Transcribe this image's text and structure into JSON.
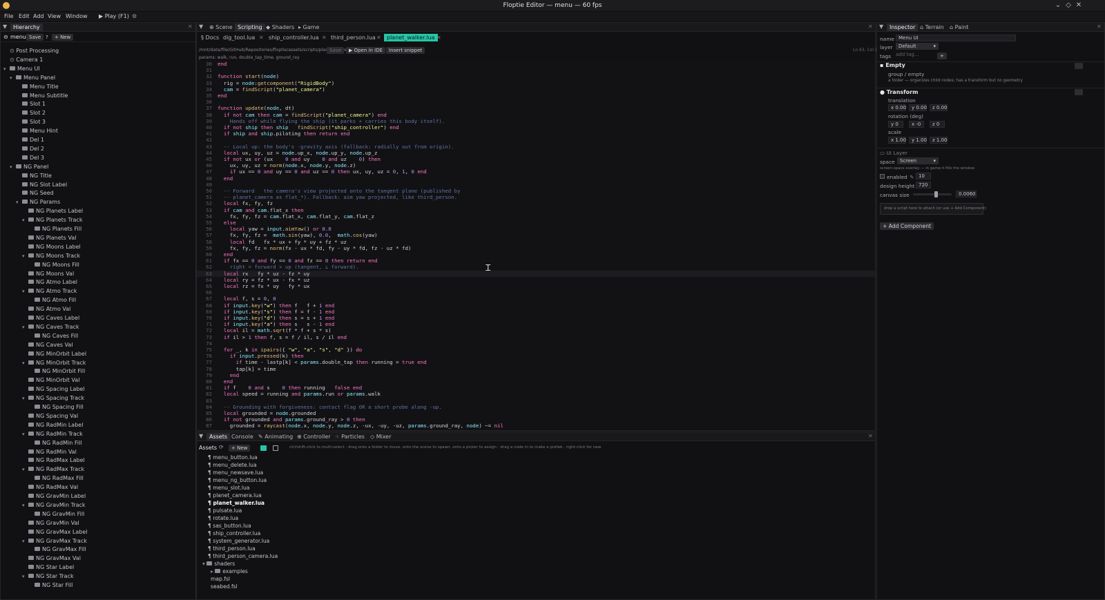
{
  "window": {
    "title": "Floptie Editor — menu — 60 fps"
  },
  "menubar": {
    "items": [
      "File",
      "Edit",
      "Add",
      "View",
      "Window"
    ],
    "play_label": "▶ Play (F1)"
  },
  "hierarchy": {
    "tab": "Hierarchy",
    "scene_name": "menu",
    "save_label": "Save",
    "help_label": "?",
    "new_label": "+ New",
    "rows": [
      {
        "label": "Post Processing",
        "depth": 0,
        "kind": "node",
        "open": false
      },
      {
        "label": "Camera 1",
        "depth": 0,
        "kind": "node",
        "open": false
      },
      {
        "label": "Menu UI",
        "depth": 0,
        "kind": "folder",
        "open": true
      },
      {
        "label": "Menu Panel",
        "depth": 1,
        "kind": "folder",
        "open": true
      },
      {
        "label": "Menu Title",
        "depth": 2,
        "kind": "folder",
        "open": false
      },
      {
        "label": "Menu Subtitle",
        "depth": 2,
        "kind": "folder",
        "open": false
      },
      {
        "label": "Slot 1",
        "depth": 2,
        "kind": "folder",
        "open": false
      },
      {
        "label": "Slot 2",
        "depth": 2,
        "kind": "folder",
        "open": false
      },
      {
        "label": "Slot 3",
        "depth": 2,
        "kind": "folder",
        "open": false
      },
      {
        "label": "Menu Hint",
        "depth": 2,
        "kind": "folder",
        "open": false
      },
      {
        "label": "Del 1",
        "depth": 2,
        "kind": "folder",
        "open": false
      },
      {
        "label": "Del 2",
        "depth": 2,
        "kind": "folder",
        "open": false
      },
      {
        "label": "Del 3",
        "depth": 2,
        "kind": "folder",
        "open": false
      },
      {
        "label": "NG Panel",
        "depth": 1,
        "kind": "folder",
        "open": true
      },
      {
        "label": "NG Title",
        "depth": 2,
        "kind": "folder",
        "open": false
      },
      {
        "label": "NG Slot Label",
        "depth": 2,
        "kind": "folder",
        "open": false
      },
      {
        "label": "NG Seed",
        "depth": 2,
        "kind": "folder",
        "open": false
      },
      {
        "label": "NG Params",
        "depth": 2,
        "kind": "folder",
        "open": true
      },
      {
        "label": "NG Planets Label",
        "depth": 3,
        "kind": "folder",
        "open": false
      },
      {
        "label": "NG Planets Track",
        "depth": 3,
        "kind": "folder",
        "open": true
      },
      {
        "label": "NG Planets Fill",
        "depth": 4,
        "kind": "folder",
        "open": false
      },
      {
        "label": "NG Planets Val",
        "depth": 3,
        "kind": "folder",
        "open": false
      },
      {
        "label": "NG Moons Label",
        "depth": 3,
        "kind": "folder",
        "open": false
      },
      {
        "label": "NG Moons Track",
        "depth": 3,
        "kind": "folder",
        "open": true
      },
      {
        "label": "NG Moons Fill",
        "depth": 4,
        "kind": "folder",
        "open": false
      },
      {
        "label": "NG Moons Val",
        "depth": 3,
        "kind": "folder",
        "open": false
      },
      {
        "label": "NG Atmo Label",
        "depth": 3,
        "kind": "folder",
        "open": false
      },
      {
        "label": "NG Atmo Track",
        "depth": 3,
        "kind": "folder",
        "open": true
      },
      {
        "label": "NG Atmo Fill",
        "depth": 4,
        "kind": "folder",
        "open": false
      },
      {
        "label": "NG Atmo Val",
        "depth": 3,
        "kind": "folder",
        "open": false
      },
      {
        "label": "NG Caves Label",
        "depth": 3,
        "kind": "folder",
        "open": false
      },
      {
        "label": "NG Caves Track",
        "depth": 3,
        "kind": "folder",
        "open": true
      },
      {
        "label": "NG Caves Fill",
        "depth": 4,
        "kind": "folder",
        "open": false
      },
      {
        "label": "NG Caves Val",
        "depth": 3,
        "kind": "folder",
        "open": false
      },
      {
        "label": "NG MinOrbit Label",
        "depth": 3,
        "kind": "folder",
        "open": false
      },
      {
        "label": "NG MinOrbit Track",
        "depth": 3,
        "kind": "folder",
        "open": true
      },
      {
        "label": "NG MinOrbit Fill",
        "depth": 4,
        "kind": "folder",
        "open": false
      },
      {
        "label": "NG MinOrbit Val",
        "depth": 3,
        "kind": "folder",
        "open": false
      },
      {
        "label": "NG Spacing Label",
        "depth": 3,
        "kind": "folder",
        "open": false
      },
      {
        "label": "NG Spacing Track",
        "depth": 3,
        "kind": "folder",
        "open": true
      },
      {
        "label": "NG Spacing Fill",
        "depth": 4,
        "kind": "folder",
        "open": false
      },
      {
        "label": "NG Spacing Val",
        "depth": 3,
        "kind": "folder",
        "open": false
      },
      {
        "label": "NG RadMin Label",
        "depth": 3,
        "kind": "folder",
        "open": false
      },
      {
        "label": "NG RadMin Track",
        "depth": 3,
        "kind": "folder",
        "open": true
      },
      {
        "label": "NG RadMin Fill",
        "depth": 4,
        "kind": "folder",
        "open": false
      },
      {
        "label": "NG RadMin Val",
        "depth": 3,
        "kind": "folder",
        "open": false
      },
      {
        "label": "NG RadMax Label",
        "depth": 3,
        "kind": "folder",
        "open": false
      },
      {
        "label": "NG RadMax Track",
        "depth": 3,
        "kind": "folder",
        "open": true
      },
      {
        "label": "NG RadMax Fill",
        "depth": 4,
        "kind": "folder",
        "open": false
      },
      {
        "label": "NG RadMax Val",
        "depth": 3,
        "kind": "folder",
        "open": false
      },
      {
        "label": "NG GravMin Label",
        "depth": 3,
        "kind": "folder",
        "open": false
      },
      {
        "label": "NG GravMin Track",
        "depth": 3,
        "kind": "folder",
        "open": true
      },
      {
        "label": "NG GravMin Fill",
        "depth": 4,
        "kind": "folder",
        "open": false
      },
      {
        "label": "NG GravMin Val",
        "depth": 3,
        "kind": "folder",
        "open": false
      },
      {
        "label": "NG GravMax Label",
        "depth": 3,
        "kind": "folder",
        "open": false
      },
      {
        "label": "NG GravMax Track",
        "depth": 3,
        "kind": "folder",
        "open": true
      },
      {
        "label": "NG GravMax Fill",
        "depth": 4,
        "kind": "folder",
        "open": false
      },
      {
        "label": "NG GravMax Val",
        "depth": 3,
        "kind": "folder",
        "open": false
      },
      {
        "label": "NG Star Label",
        "depth": 3,
        "kind": "folder",
        "open": false
      },
      {
        "label": "NG Star Track",
        "depth": 3,
        "kind": "folder",
        "open": true
      },
      {
        "label": "NG Star Fill",
        "depth": 4,
        "kind": "folder",
        "open": false
      }
    ]
  },
  "editor": {
    "top_tabs": [
      "⊕ Scene",
      "Scripting",
      "◆ Shaders",
      "▸ Game"
    ],
    "active_top_tab": 1,
    "file_tabs": [
      "§ Docs",
      "dig_tool.lua",
      "ship_controller.lua",
      "third_person.lua",
      "planet_walker.lua"
    ],
    "active_file_tab": 4,
    "path": "/mnt/data/file/GitHub/Repositories/floptie/assets/scripts/planet_walker.lua",
    "save_label": "Save",
    "open_ide_label": "▶ Open in IDE",
    "insert_snippet_label": "Insert snippet",
    "cursor_pos": "Ln 63, Col 11",
    "params_line": "params: walk, run, double_tap_time, ground_ray",
    "accent_color": "#26c6a6",
    "code": [
      {
        "n": 30,
        "t": "end"
      },
      {
        "n": 31,
        "t": ""
      },
      {
        "n": 32,
        "t": "function start(node)"
      },
      {
        "n": 33,
        "t": "  rig = node:getcomponent(\"RigidBody\")"
      },
      {
        "n": 34,
        "t": "  cam = findScript(\"planet_camera\")"
      },
      {
        "n": 35,
        "t": "end"
      },
      {
        "n": 36,
        "t": ""
      },
      {
        "n": 37,
        "t": "function update(node, dt)"
      },
      {
        "n": 38,
        "t": "  if not cam then cam = findScript(\"planet_camera\") end"
      },
      {
        "n": 39,
        "t": "    Hands off while flying the ship (it parks + carries this body itself)."
      },
      {
        "n": 40,
        "t": "  if not ship then ship   findScript(\"ship_controller\") end"
      },
      {
        "n": 41,
        "t": "  if ship and ship.piloting then return end"
      },
      {
        "n": 42,
        "t": ""
      },
      {
        "n": 43,
        "t": "  -- Local up: the body's -gravity axis (fallback: radially out from origin)."
      },
      {
        "n": 44,
        "t": "  local ux, uy, uz = node.up_x, node.up_y, node.up_z"
      },
      {
        "n": 45,
        "t": "  if not ux or (ux    0 and uy    0 and uz    0) then"
      },
      {
        "n": 46,
        "t": "    ux, uy, uz = norm(node.x, node.y, node.z)"
      },
      {
        "n": 47,
        "t": "    if ux == 0 and uy == 0 and uz == 0 then ux, uy, uz = 0, 1, 0 end"
      },
      {
        "n": 48,
        "t": "  end"
      },
      {
        "n": 49,
        "t": ""
      },
      {
        "n": 50,
        "t": "  -- Forward   the camera's view projected onto the tangent plane (published by"
      },
      {
        "n": 51,
        "t": "  -- planet_camera as flat_*). Fallback: aim yaw projected, like third_person."
      },
      {
        "n": 52,
        "t": "  local fx, fy, fz"
      },
      {
        "n": 53,
        "t": "  if cam and cam.flat_x then"
      },
      {
        "n": 54,
        "t": "    fx, fy, fz = cam.flat_x, cam.flat_y, cam.flat_z"
      },
      {
        "n": 55,
        "t": "  else"
      },
      {
        "n": 56,
        "t": "    local yaw = input.aimYaw() or 0.0"
      },
      {
        "n": 57,
        "t": "    fx, fy, fz =  math.sin(yaw), 0.0,  math.cos(yaw)"
      },
      {
        "n": 58,
        "t": "    local fd   fx * ux + fy * uy + fz * uz"
      },
      {
        "n": 59,
        "t": "    fx, fy, fz = norm(fx - ux * fd, fy - uy * fd, fz - uz * fd)"
      },
      {
        "n": 60,
        "t": "  end"
      },
      {
        "n": 61,
        "t": "  if fx == 0 and fy == 0 and fz == 0 then return end"
      },
      {
        "n": 62,
        "t": "    right = forward × up (tangent, ⊥ forward)."
      },
      {
        "n": 63,
        "t": "  local rx   fy * uz - fz * uy"
      },
      {
        "n": 64,
        "t": "  local ry = fz * ux - fx * uz"
      },
      {
        "n": 65,
        "t": "  local rz = fx * uy   fy * ux"
      },
      {
        "n": 66,
        "t": ""
      },
      {
        "n": 67,
        "t": "  local f, s = 0, 0"
      },
      {
        "n": 68,
        "t": "  if input.key(\"w\") then f   f + 1 end"
      },
      {
        "n": 69,
        "t": "  if input.key(\"s\") then f = f - 1 end"
      },
      {
        "n": 70,
        "t": "  if input.key(\"d\") then s = s + 1 end"
      },
      {
        "n": 71,
        "t": "  if input.key(\"a\") then s   s - 1 end"
      },
      {
        "n": 72,
        "t": "  local il = math.sqrt(f * f + s * s)"
      },
      {
        "n": 73,
        "t": "  if il > 1 then f, s = f / il, s / il end"
      },
      {
        "n": 74,
        "t": ""
      },
      {
        "n": 75,
        "t": "  for _, k in ipairs({ \"w\", \"a\", \"s\", \"d\" }) do"
      },
      {
        "n": 76,
        "t": "    if input.pressed(k) then"
      },
      {
        "n": 77,
        "t": "      if time - lastp[k] < params.double_tap then running = true end"
      },
      {
        "n": 78,
        "t": "      tap[k] = time"
      },
      {
        "n": 79,
        "t": "    end"
      },
      {
        "n": 80,
        "t": "  end"
      },
      {
        "n": 81,
        "t": "  if f    0 and s    0 then running   false end"
      },
      {
        "n": 82,
        "t": "  local speed = running and params.run or params.walk"
      },
      {
        "n": 83,
        "t": ""
      },
      {
        "n": 84,
        "t": "  -- Grounding with forgiveness: contact flag OR a short probe along -up."
      },
      {
        "n": 85,
        "t": "  local grounded = node.grounded"
      },
      {
        "n": 86,
        "t": "  if not grounded and params.ground_ray > 0 then"
      },
      {
        "n": 87,
        "t": "    grounded = raycast(node.x, node.y, node.z, -ux, -uy, -uz, params.ground_ray, node) ~= nil"
      }
    ]
  },
  "assets": {
    "tabs": [
      "Assets",
      "Console",
      "✎ Animating",
      "⊕ Controller",
      "⁘ Particles",
      "◇ Mixer"
    ],
    "active_tab": 0,
    "title": "Assets",
    "new_label": "+ New",
    "hint": "ctrl/shift-click to multi-select · drag onto a folder to move, onto the scene to spawn, onto a picker to assign · drag a node in to make a prefab · right-click for new",
    "items": [
      {
        "label": "¶ menu_button.lua",
        "selected": false
      },
      {
        "label": "¶ menu_delete.lua",
        "selected": false
      },
      {
        "label": "¶ menu_newsave.lua",
        "selected": false
      },
      {
        "label": "¶ menu_ng_button.lua",
        "selected": false
      },
      {
        "label": "¶ menu_slot.lua",
        "selected": false
      },
      {
        "label": "¶ planet_camera.lua",
        "selected": false
      },
      {
        "label": "¶ planet_walker.lua",
        "selected": true
      },
      {
        "label": "¶ pulsate.lua",
        "selected": false
      },
      {
        "label": "¶ rotate.lua",
        "selected": false
      },
      {
        "label": "¶ sas_button.lua",
        "selected": false
      },
      {
        "label": "¶ ship_controller.lua",
        "selected": false
      },
      {
        "label": "¶ system_generator.lua",
        "selected": false
      },
      {
        "label": "¶ third_person.lua",
        "selected": false
      },
      {
        "label": "¶ third_person_camera.lua",
        "selected": false
      },
      {
        "label": "shaders",
        "selected": false,
        "folder": true,
        "open": true
      },
      {
        "label": "examples",
        "selected": false,
        "folder": true,
        "open": false,
        "sub": true
      },
      {
        "label": "map.fsl",
        "selected": false,
        "sub": true
      },
      {
        "label": "seabed.fsl",
        "selected": false,
        "sub": true
      }
    ]
  },
  "inspector": {
    "tabs": [
      "Inspector",
      "⌂ Terrain",
      "⌂ Paint"
    ],
    "active_tab": 0,
    "name_label": "name",
    "name_value": "Menu UI",
    "layer_label": "layer",
    "layer_value": "Default",
    "tags_label": "tags",
    "tags_placeholder": "add tag...",
    "tags_add": "+",
    "empty_header": "Empty",
    "empty_sub": "group / empty",
    "empty_desc": "a folder — organizes child nodes; has a transform but no geometry",
    "transform_header": "Transform",
    "translation_label": "translation",
    "translation": [
      "x 0.00",
      "y 0.00",
      "z 0.00"
    ],
    "rotation_label": "rotation (deg)",
    "rotation": [
      "y 0",
      "x -0",
      "z 0"
    ],
    "scale_label": "scale",
    "scale": [
      "x 1.00",
      "y 1.00",
      "z 1.00"
    ],
    "uilayer_header": "UI Layer",
    "space_label": "space",
    "space_value": "Screen",
    "space_desc": "screen-space overlay — in game it fills the window",
    "enabled_label": "enabled",
    "enabled_value": "10",
    "design_height_label": "design height",
    "design_height_value": "720",
    "canvas_size_label": "canvas size",
    "canvas_size_value": "0.0060",
    "canvas_size_fraction": 0.55,
    "drop_script_hint": "drop a script here to attach (or use + Add Component)",
    "add_component_label": "+ Add Component"
  }
}
